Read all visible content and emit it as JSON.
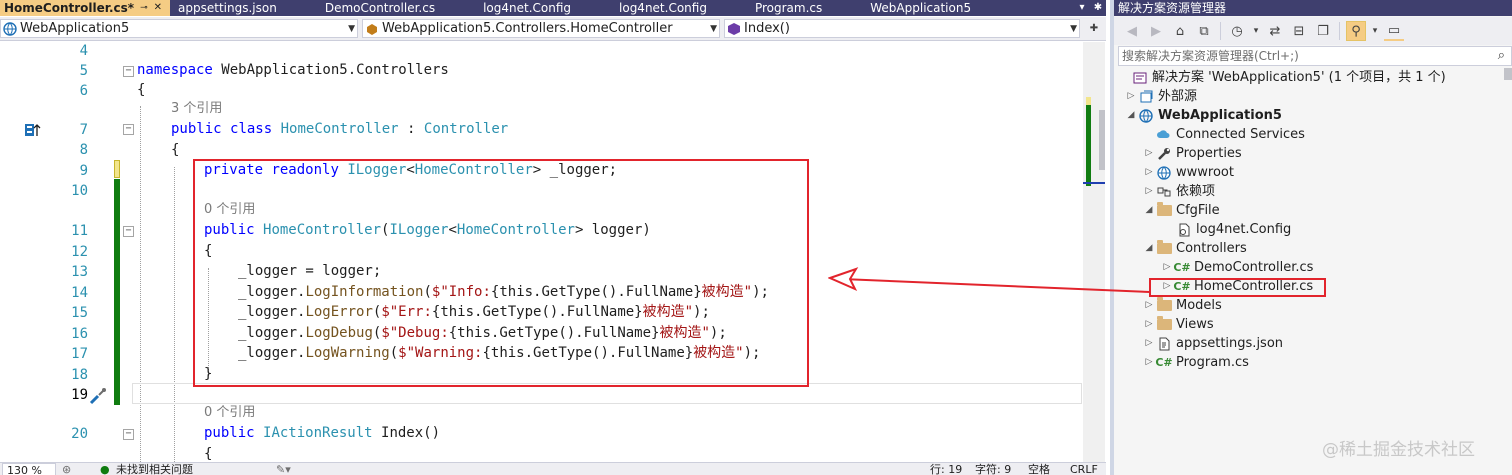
{
  "editor": {
    "tabs": [
      {
        "label": "HomeController.cs*",
        "active": true
      },
      {
        "label": "appsettings.json"
      },
      {
        "label": "DemoController.cs"
      },
      {
        "label": "log4net.Config"
      },
      {
        "label": "log4net.Config"
      },
      {
        "label": "Program.cs"
      },
      {
        "label": "WebApplication5"
      }
    ],
    "nav": {
      "project": "WebApplication5",
      "class": "WebApplication5.Controllers.HomeController",
      "member": "Index()"
    },
    "line_numbers": [
      "4",
      "5",
      "6",
      "",
      "7",
      "8",
      "9",
      "10",
      "",
      "11",
      "12",
      "13",
      "14",
      "15",
      "16",
      "17",
      "18",
      "19",
      "",
      "20",
      ""
    ],
    "refs": {
      "class_refs": "3 个引用",
      "ctor_refs": "0 个引用",
      "index_refs": "0 个引用"
    },
    "code": {
      "ns_kw": "namespace",
      "ns_name": " WebApplication5.Controllers",
      "open_brace": "{",
      "close_brace": "}",
      "public": "public",
      "class": "class",
      "class_name": "HomeController",
      "colon": " : ",
      "base": "Controller",
      "private": "private",
      "readonly": "readonly",
      "ilogger": "ILogger",
      "lt": "<",
      "gt": ">",
      "field": " _logger;",
      "ctor_name": "HomeController",
      "param": " logger)",
      "paren_open": "(",
      "assign": "_logger = logger;",
      "logger_dot": "_logger.",
      "log_info": "LogInformation",
      "log_err": "LogError",
      "log_debug": "LogDebug",
      "log_warn": "LogWarning",
      "str_info_a": "$\"Info:",
      "str_err_a": "$\"Err:",
      "str_debug_a": "$\"Debug:",
      "str_warn_a": "$\"Warning:",
      "interp": "{this.GetType().FullName}",
      "str_tail": "被构造\"",
      "call_end": ");",
      "iaction": "IActionResult",
      "index_sig": " Index()"
    },
    "status": {
      "zoom": "130 %",
      "issues": "未找到相关问题",
      "line": "行: 19",
      "char": "字符: 9",
      "space": "空格",
      "eol": "CRLF"
    }
  },
  "solution_explorer": {
    "title": "解决方案资源管理器",
    "search_placeholder": "搜索解决方案资源管理器(Ctrl+;)",
    "items": [
      {
        "label": "解决方案 'WebApplication5' (1 个项目，共 1 个)"
      },
      {
        "label": "外部源"
      },
      {
        "label": "WebApplication5"
      },
      {
        "label": "Connected Services"
      },
      {
        "label": "Properties"
      },
      {
        "label": "wwwroot"
      },
      {
        "label": "依赖项"
      },
      {
        "label": "CfgFile"
      },
      {
        "label": "log4net.Config"
      },
      {
        "label": "Controllers"
      },
      {
        "label": "DemoController.cs"
      },
      {
        "label": "HomeController.cs"
      },
      {
        "label": "Models"
      },
      {
        "label": "Views"
      },
      {
        "label": "appsettings.json"
      },
      {
        "label": "Program.cs"
      }
    ]
  },
  "watermark": "@稀土掘金技术社区",
  "colors": {
    "tab_bar": "#3f3f6e",
    "active_tab": "#f5cc84",
    "keyword": "#0000ff",
    "type": "#2b91af",
    "string": "#a31515",
    "method": "#74531f",
    "highlight_box": "#e2242c",
    "change_bar": "#107c10"
  },
  "icons": {
    "solution": "solution-icon",
    "external_sources": "external-sources-icon",
    "project": "web-project-icon",
    "connected_services": "cloud-services-icon",
    "properties": "wrench-icon",
    "wwwroot": "globe-icon",
    "dependencies": "dependencies-icon",
    "folder": "folder-icon",
    "config": "config-file-icon",
    "csharp": "csharp-file-icon",
    "json": "json-file-icon"
  }
}
